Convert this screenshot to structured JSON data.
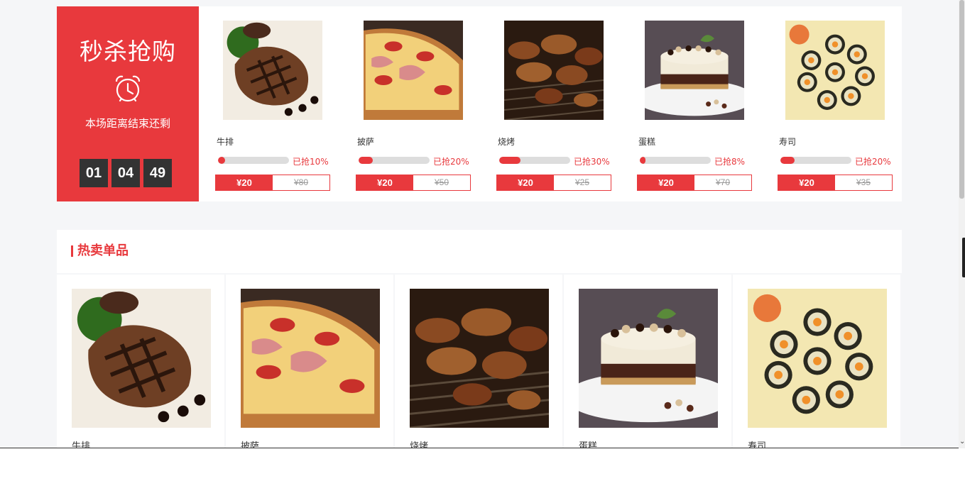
{
  "flash_sale": {
    "title": "秒杀抢购",
    "icon": "alarm-clock-icon",
    "subtitle": "本场距离结束还剩",
    "countdown": {
      "hours": "01",
      "minutes": "04",
      "seconds": "49"
    },
    "items": [
      {
        "name": "牛排",
        "sold_pct": 10,
        "sold_label": "已抢10%",
        "price": "¥20",
        "orig_price": "¥80",
        "image": "steak"
      },
      {
        "name": "披萨",
        "sold_pct": 20,
        "sold_label": "已抢20%",
        "price": "¥20",
        "orig_price": "¥50",
        "image": "pizza"
      },
      {
        "name": "烧烤",
        "sold_pct": 30,
        "sold_label": "已抢30%",
        "price": "¥20",
        "orig_price": "¥25",
        "image": "bbq"
      },
      {
        "name": "蛋糕",
        "sold_pct": 8,
        "sold_label": "已抢8%",
        "price": "¥20",
        "orig_price": "¥70",
        "image": "cake"
      },
      {
        "name": "寿司",
        "sold_pct": 20,
        "sold_label": "已抢20%",
        "price": "¥20",
        "orig_price": "¥35",
        "image": "sushi"
      }
    ]
  },
  "hot": {
    "title": "热卖单品",
    "items": [
      {
        "name": "牛排",
        "image": "steak"
      },
      {
        "name": "披萨",
        "image": "pizza"
      },
      {
        "name": "烧烤",
        "image": "bbq"
      },
      {
        "name": "蛋糕",
        "image": "cake"
      },
      {
        "name": "寿司",
        "image": "sushi"
      }
    ]
  },
  "colors": {
    "accent": "#e8393d",
    "countdown_bg": "#333333",
    "page_bg": "#f5f6f8"
  }
}
